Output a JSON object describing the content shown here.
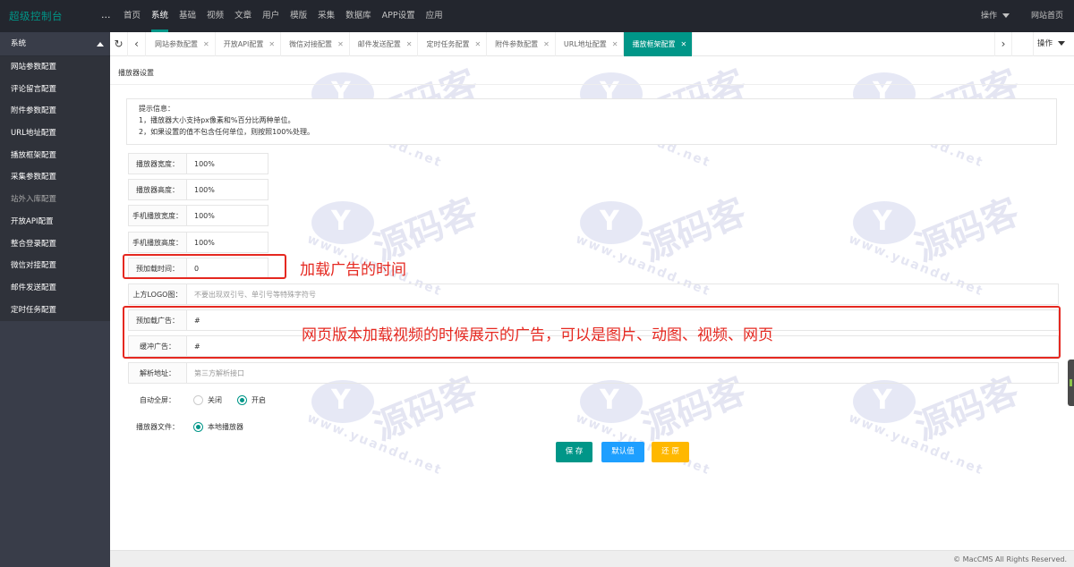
{
  "app": {
    "title": "超级控制台",
    "more": "..."
  },
  "topnav": [
    "首页",
    "系统",
    "基础",
    "视频",
    "文章",
    "用户",
    "模版",
    "采集",
    "数据库",
    "APP设置",
    "应用"
  ],
  "topnav_active": 1,
  "topright": {
    "ops": "操作",
    "site_home": "网站首页"
  },
  "sidebar": {
    "header": "系统",
    "items": [
      {
        "label": "网站参数配置"
      },
      {
        "label": "评论留言配置"
      },
      {
        "label": "附件参数配置"
      },
      {
        "label": "URL地址配置"
      },
      {
        "label": "播放框架配置"
      },
      {
        "label": "采集参数配置"
      },
      {
        "label": "站外入库配置"
      },
      {
        "label": "开放API配置"
      },
      {
        "label": "整合登录配置"
      },
      {
        "label": "微信对接配置"
      },
      {
        "label": "邮件发送配置"
      },
      {
        "label": "定时任务配置"
      }
    ]
  },
  "tabs": [
    {
      "label": "网站参数配置"
    },
    {
      "label": "开放API配置"
    },
    {
      "label": "微信对接配置"
    },
    {
      "label": "邮件发送配置"
    },
    {
      "label": "定时任务配置"
    },
    {
      "label": "附件参数配置"
    },
    {
      "label": "URL地址配置"
    },
    {
      "label": "播放框架配置"
    }
  ],
  "tab_close": "✕",
  "tab_ops": "操作",
  "page": {
    "title": "播放器设置",
    "tips": {
      "heading": "提示信息：",
      "line1": "1，播放器大小支持px像素和%百分比两种单位。",
      "line2": "2，如果设置的值不包含任何单位，则按照100%处理。"
    },
    "fields": {
      "width": {
        "label": "播放器宽度：",
        "value": "100%"
      },
      "height": {
        "label": "播放器高度：",
        "value": "100%"
      },
      "m_width": {
        "label": "手机播放宽度：",
        "value": "100%"
      },
      "m_height": {
        "label": "手机播放高度：",
        "value": "100%"
      },
      "preload_time": {
        "label": "预加载时间：",
        "value": "0"
      },
      "logo": {
        "label": "上方LOGO图：",
        "placeholder": "不要出现双引号、单引号等特殊字符号"
      },
      "preload_ad": {
        "label": "预加载广告：",
        "value": "#"
      },
      "buffer_ad": {
        "label": "缓冲广告：",
        "value": "#"
      },
      "parse": {
        "label": "解析地址：",
        "placeholder": "第三方解析接口"
      }
    },
    "autofull": {
      "label": "自动全屏：",
      "off": "关闭",
      "on": "开启",
      "selected": "开启"
    },
    "player_file": {
      "label": "播放器文件：",
      "option": "本地播放器"
    },
    "buttons": {
      "save": "保 存",
      "default": "默认值",
      "restore": "还 原"
    }
  },
  "annotations": {
    "a1": "加载广告的时间",
    "a2": "网页版本加载视频的时候展示的广告，可以是图片、动图、视频、网页",
    "color": "#e52820"
  },
  "watermark": {
    "brand": "源码客",
    "url": "www.yuandd.net"
  },
  "footer": "© MacCMS All Rights Reserved."
}
